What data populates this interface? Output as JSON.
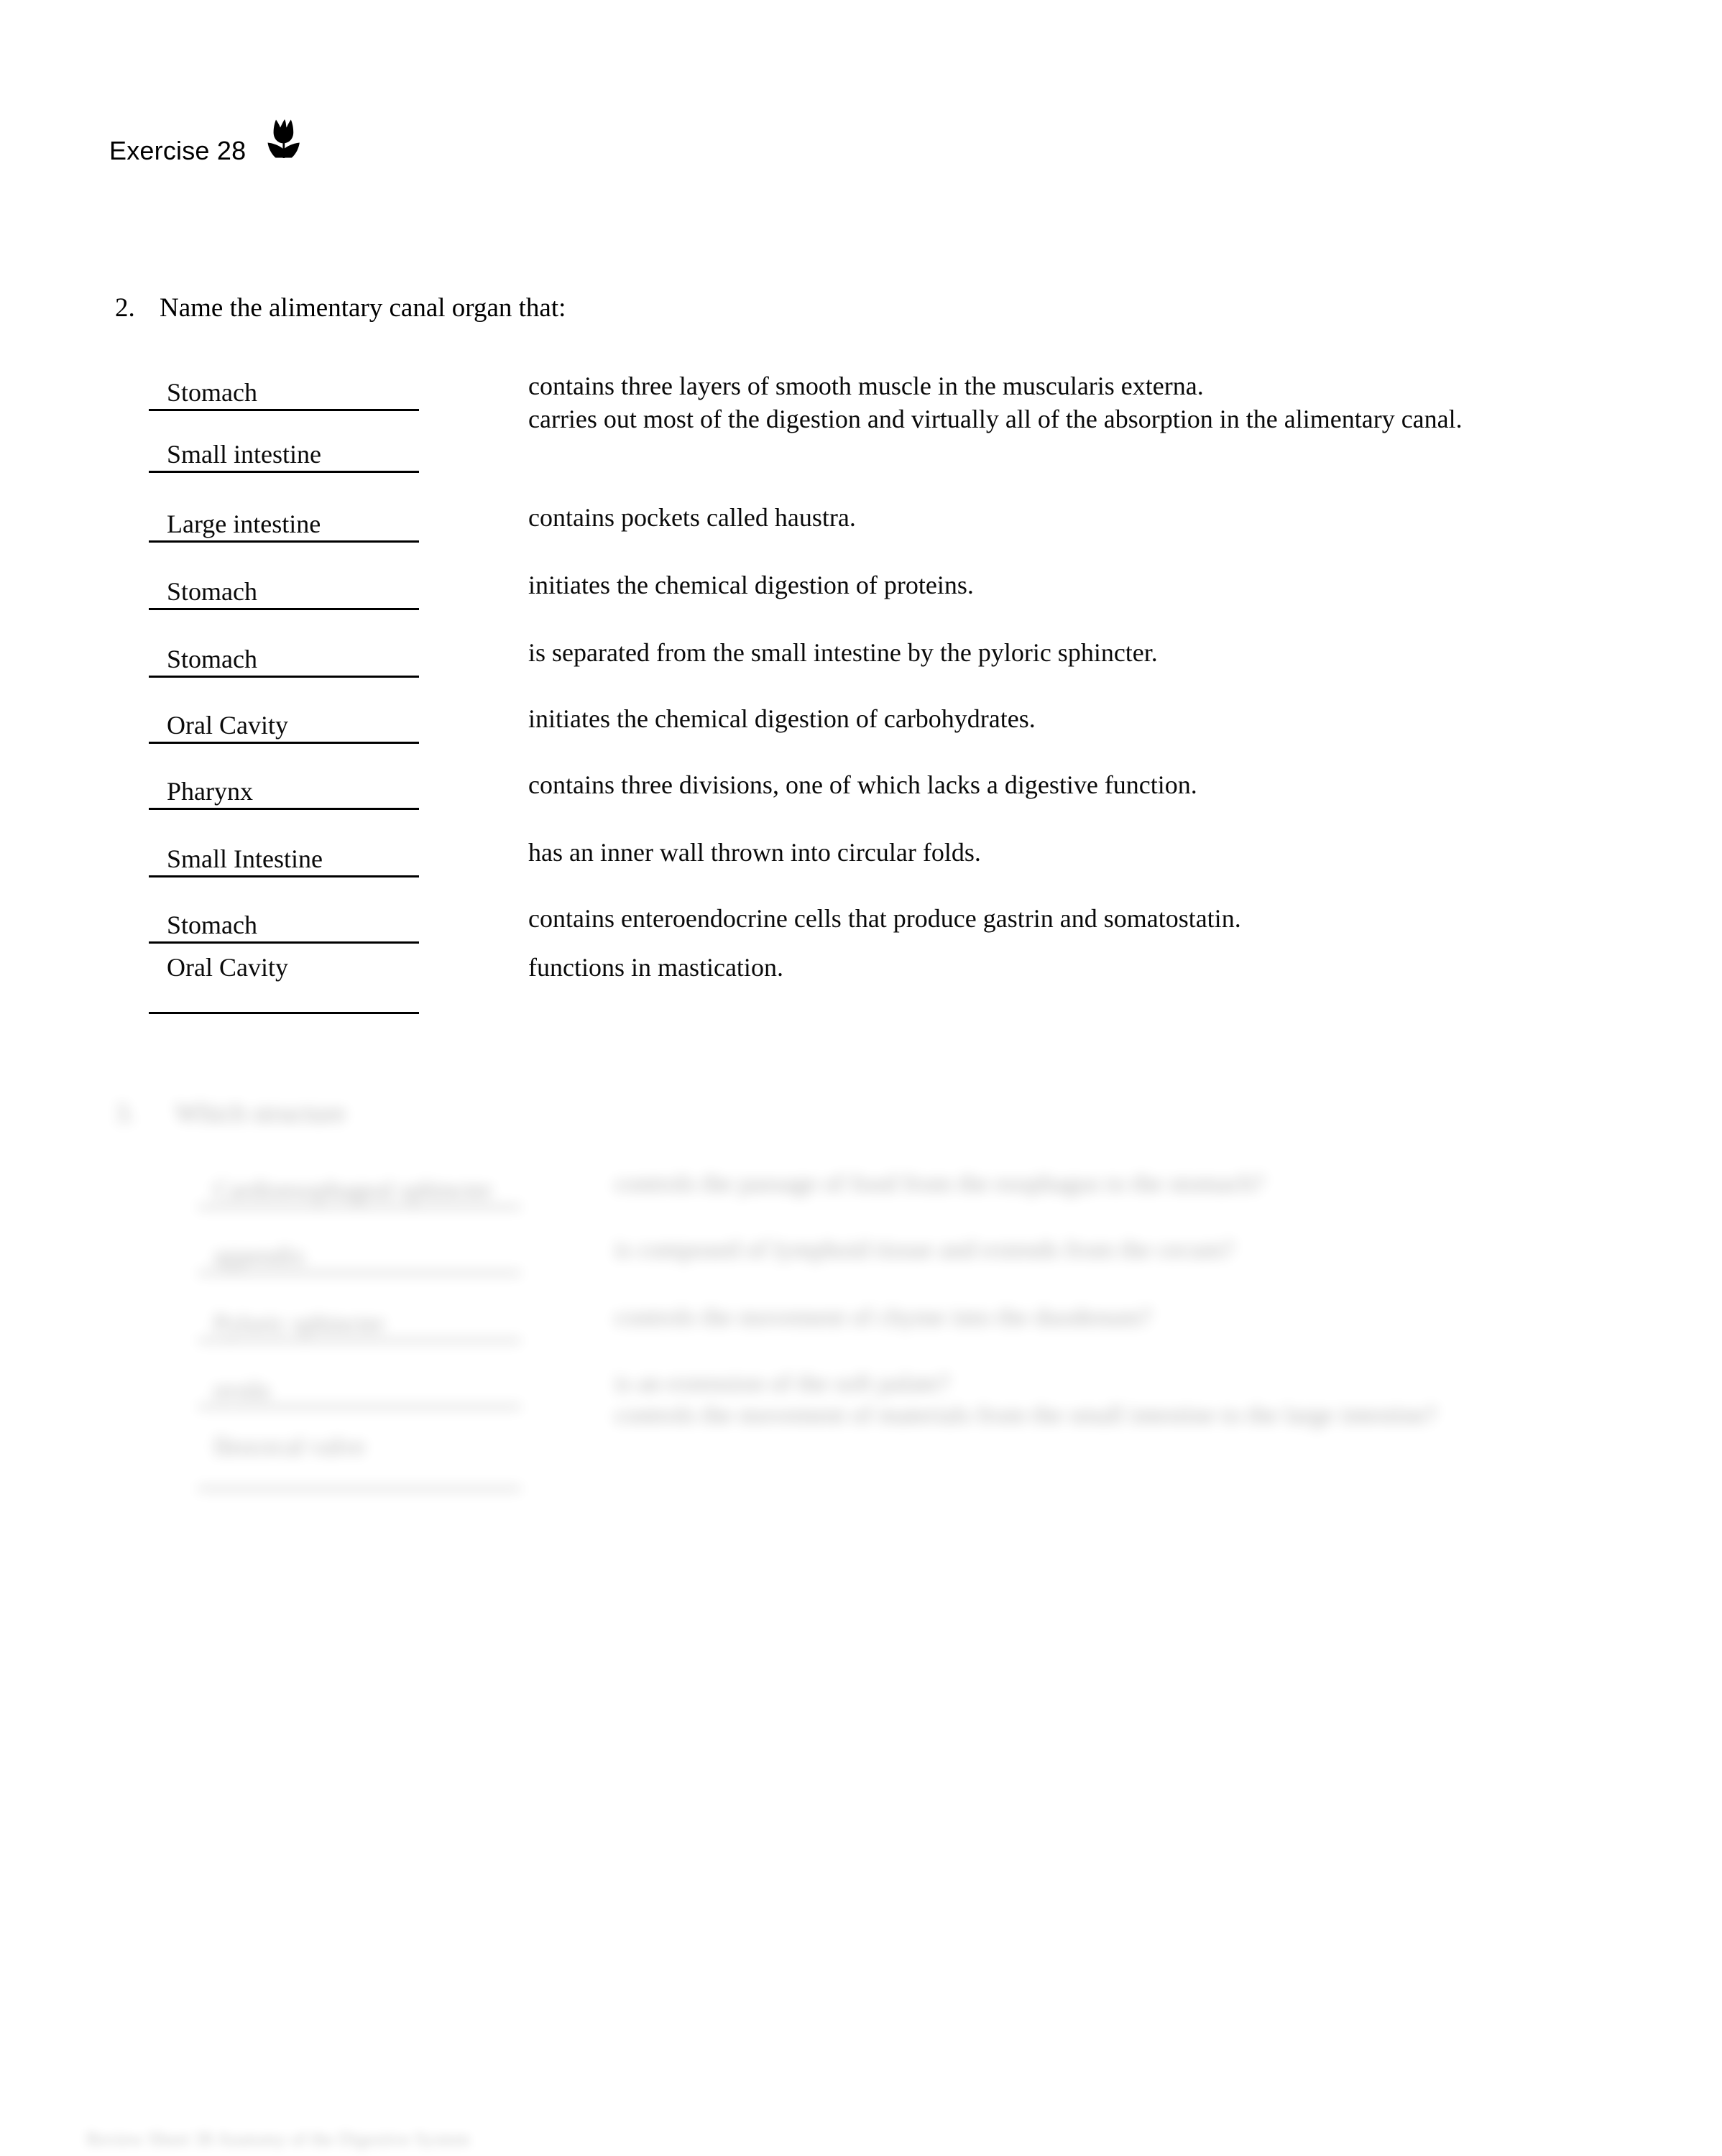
{
  "header": {
    "exercise_label": "Exercise 28",
    "flower_icon": "tulip-icon"
  },
  "question2": {
    "number": "2.",
    "prompt": "Name the alimentary canal organ that:",
    "rows": [
      {
        "answer": "Stomach",
        "description": "contains three layers of smooth muscle in the muscularis externa."
      },
      {
        "answer": "Small intestine",
        "description": "carries out most of the digestion and virtually all of the absorption in the alimentary canal."
      },
      {
        "answer": "Large intestine",
        "description": "contains pockets called haustra."
      },
      {
        "answer": "Stomach",
        "description": "initiates the chemical digestion of proteins."
      },
      {
        "answer": "Stomach",
        "description": "is separated from the small intestine by the pyloric sphincter."
      },
      {
        "answer": "Oral Cavity",
        "description": "initiates the chemical digestion of carbohydrates."
      },
      {
        "answer": "Pharynx",
        "description": "contains three divisions, one of which lacks a digestive function."
      },
      {
        "answer": "Small Intestine",
        "description": "has an inner wall thrown into circular folds."
      },
      {
        "answer": "Stomach",
        "description": "contains enteroendocrine cells that produce gastrin and somatostatin."
      },
      {
        "answer": "Oral Cavity",
        "description": "functions in mastication."
      }
    ]
  },
  "question3": {
    "number": "3.",
    "prompt": "Which structure",
    "rows": [
      {
        "answer": "Cardioesophageal sphincter",
        "description": "controls the passage of food from the esophagus to the stomach?"
      },
      {
        "answer": "appendix",
        "description": "is composed of lymphoid tissue and extends from the cecum?"
      },
      {
        "answer": "Pyloric sphincter",
        "description": "controls the movement of chyme into the duodenum?"
      },
      {
        "answer": "uvula",
        "description": "is an extension of the soft palate?"
      },
      {
        "answer": "Ileocecal valve",
        "description": "controls the movement of materials from the small intestine to the large intestine?"
      }
    ]
  },
  "footer": {
    "text": "Review Sheet 38 Anatomy of the Digestive System"
  }
}
